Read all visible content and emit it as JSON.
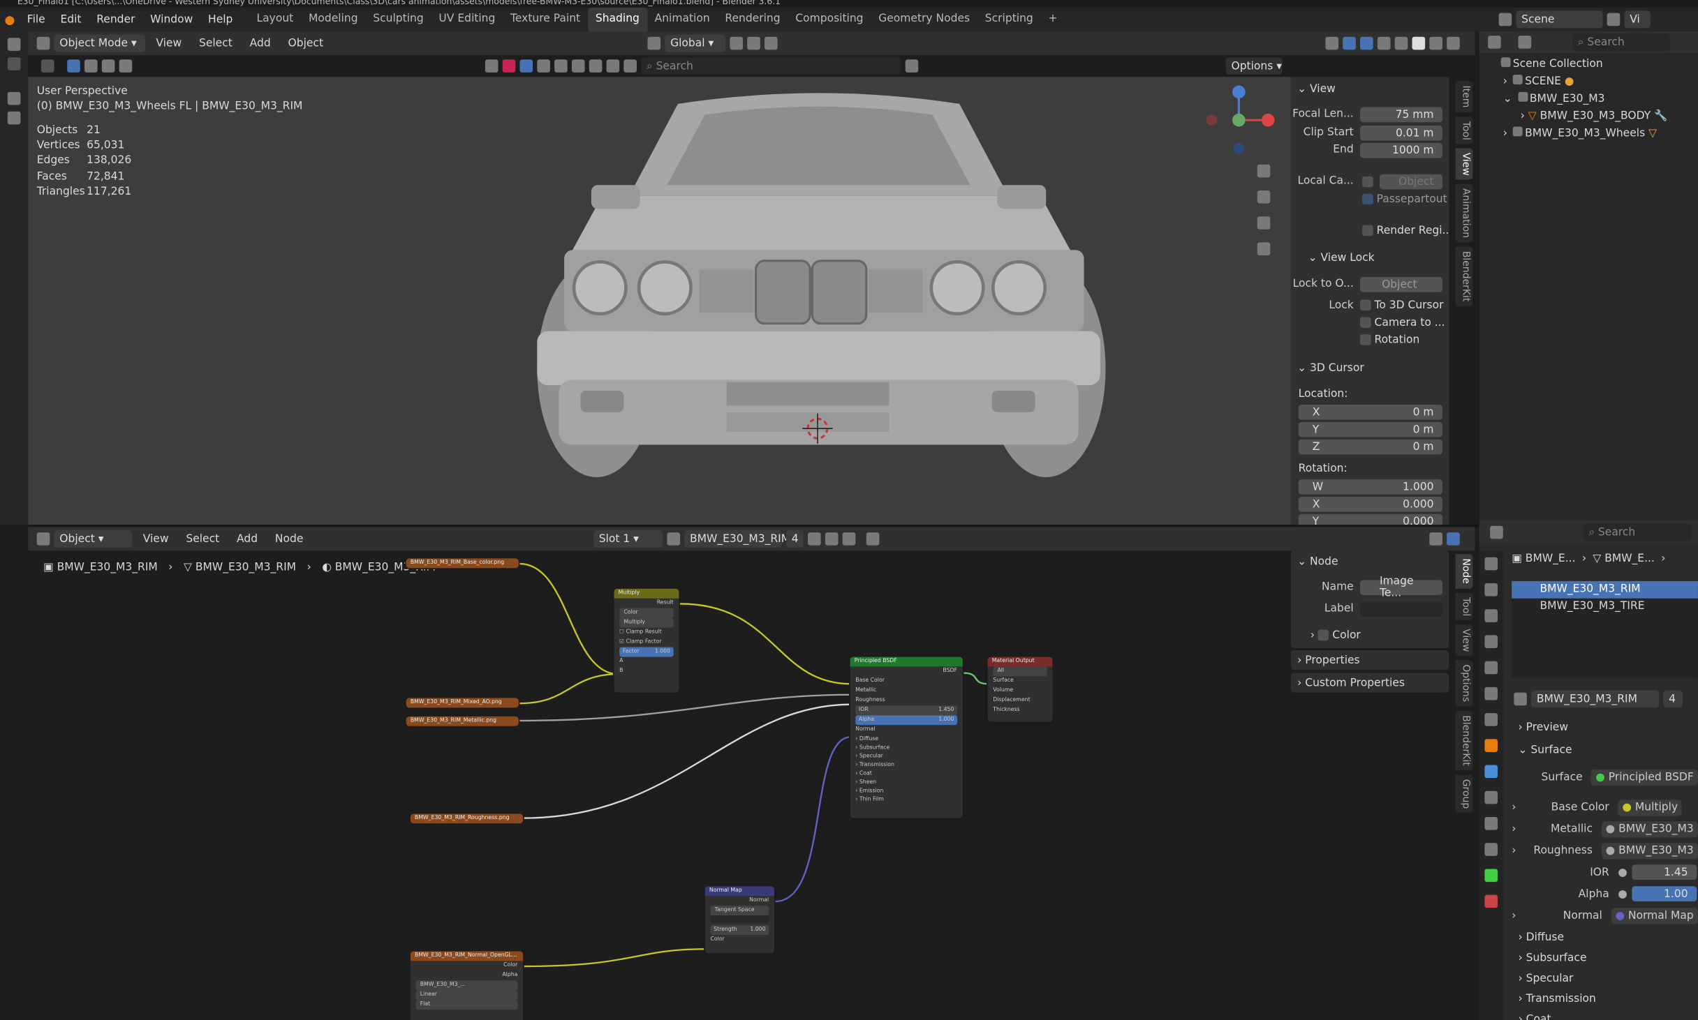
{
  "title_bar": {
    "text": "E30_Finalo1 [C:\\Users\\...\\OneDrive - Western Sydney University\\Documents\\Class\\3D\\cars animation\\assets\\models\\free-BMW-M3-E30\\source\\E30_Finalo1.blend] - Blender 3.6.1"
  },
  "menu": [
    "File",
    "Edit",
    "Render",
    "Window",
    "Help"
  ],
  "workspaces": [
    "Layout",
    "Modeling",
    "Sculpting",
    "UV Editing",
    "Texture Paint",
    "Shading",
    "Animation",
    "Rendering",
    "Compositing",
    "Geometry Nodes",
    "Scripting"
  ],
  "active_workspace": "Shading",
  "scene": {
    "label": "Scene",
    "view_layer": "Vi"
  },
  "viewport": {
    "mode": "Object Mode",
    "menus": [
      "View",
      "Select",
      "Add",
      "Object"
    ],
    "orientation": "Global",
    "options": "Options",
    "search_placeholder": "Search",
    "perspective": "User Perspective",
    "active": "(0) BMW_E30_M3_Wheels FL | BMW_E30_M3_RIM",
    "stats": [
      {
        "label": "Objects",
        "value": "21"
      },
      {
        "label": "Vertices",
        "value": "65,031"
      },
      {
        "label": "Edges",
        "value": "138,026"
      },
      {
        "label": "Faces",
        "value": "72,841"
      },
      {
        "label": "Triangles",
        "value": "117,261"
      }
    ]
  },
  "view_panel": {
    "view_header": "View",
    "focal_label": "Focal Len...",
    "focal_value": "75 mm",
    "clip_start_label": "Clip Start",
    "clip_start_value": "0.01 m",
    "end_label": "End",
    "end_value": "1000 m",
    "local_cam_label": "Local Ca...",
    "local_cam_value": "Object",
    "passepartout": "Passepartout",
    "render_region": "Render Regi...",
    "view_lock_header": "View Lock",
    "lock_to_label": "Lock to O...",
    "lock_to_value": "Object",
    "lock_label": "Lock",
    "to_3d_cursor": "To 3D Cursor",
    "camera_to": "Camera to ...",
    "rotation_cb": "Rotation",
    "cursor_header": "3D Cursor",
    "location_label": "Location:",
    "x_label": "X",
    "x_value": "0 m",
    "y_label": "Y",
    "y_value": "0 m",
    "z_label": "Z",
    "z_value": "0 m",
    "rotation_label": "Rotation:",
    "w_label": "W",
    "w_value": "1.000",
    "rx_label": "X",
    "rx_value": "0.000",
    "ry_label": "Y",
    "ry_value": "0.000"
  },
  "viewport_tabs": [
    "Item",
    "Tool",
    "View",
    "Animation",
    "BlenderKit"
  ],
  "outliner": {
    "search_placeholder": "Search",
    "items": [
      {
        "label": "Scene Collection"
      },
      {
        "label": "SCENE"
      },
      {
        "label": "BMW_E30_M3"
      },
      {
        "label": "BMW_E30_M3_BODY"
      },
      {
        "label": "BMW_E30_M3_Wheels"
      }
    ]
  },
  "node_editor": {
    "type": "Object",
    "menus": [
      "View",
      "Select",
      "Add",
      "Node"
    ],
    "slot": "Slot 1",
    "material": "BMW_E30_M3_RIM",
    "users": "4",
    "breadcrumb": [
      "BMW_E30_M3_RIM",
      "BMW_E30_M3_RIM",
      "BMW_E30_M3_RIM"
    ]
  },
  "node_panel": {
    "node_header": "Node",
    "name_label": "Name",
    "name_value": "Image Te...",
    "label_label": "Label",
    "color_label": "Color",
    "properties": "Properties",
    "custom_properties": "Custom Properties"
  },
  "node_tabs": [
    "Node",
    "Tool",
    "View",
    "Options",
    "BlenderKit",
    "Group"
  ],
  "nodes": {
    "base_color_img": "BMW_E30_M3_RIM_Base_color.png",
    "mixed_ao_img": "BMW_E30_M3_RIM_Mixed_AO.png",
    "metallic_img": "BMW_E30_M3_RIM_Metallic.png",
    "roughness_img": "BMW_E30_M3_RIM_Roughness.png",
    "normal_img": "BMW_E30_M3_RIM_Normal_OpenGL...",
    "normal_img_file": "BMW_E30_M3_...",
    "normal_img_interp": "Linear",
    "normal_img_proj": "Flat",
    "normal_img_color": "Color",
    "normal_img_alpha": "Alpha",
    "multiply": {
      "title": "Multiply",
      "result": "Result",
      "color": "Color",
      "blend": "Multiply",
      "clamp_result": "Clamp Result",
      "clamp_factor": "Clamp Factor",
      "factor_label": "Factor",
      "factor": "1.000",
      "a": "A",
      "b": "B"
    },
    "bsdf": {
      "title": "Principled BSDF",
      "out": "BSDF",
      "base": "Base Color",
      "metallic": "Metallic",
      "roughness": "Roughness",
      "ior_label": "IOR",
      "ior": "1.450",
      "alpha_label": "Alpha",
      "alpha": "1.000",
      "normal": "Normal",
      "subs": [
        "Diffuse",
        "Subsurface",
        "Specular",
        "Transmission",
        "Coat",
        "Sheen",
        "Emission",
        "Thin Film"
      ]
    },
    "output": {
      "title": "Material Output",
      "target": "All",
      "surface": "Surface",
      "volume": "Volume",
      "displacement": "Displacement",
      "thickness": "Thickness"
    },
    "normal_map": {
      "title": "Normal Map",
      "out": "Normal",
      "space": "Tangent Space",
      "strength_label": "Strength",
      "strength": "1.000",
      "color": "Color"
    }
  },
  "properties": {
    "search_placeholder": "Search",
    "crumb1": "BMW_E...",
    "crumb2": "BMW_E...",
    "slots": [
      "BMW_E30_M3_RIM",
      "BMW_E30_M3_TIRE"
    ],
    "material": "BMW_E30_M3_RIM",
    "users": "4",
    "preview": "Preview",
    "surface_header": "Surface",
    "surface_label": "Surface",
    "surface_value": "Principled BSDF",
    "rows": [
      {
        "label": "Base Color",
        "value": "Multiply"
      },
      {
        "label": "Metallic",
        "value": "BMW_E30_M3"
      },
      {
        "label": "Roughness",
        "value": "BMW_E30_M3"
      },
      {
        "label": "IOR",
        "value": "1.45"
      },
      {
        "label": "Alpha",
        "value": "1.00"
      },
      {
        "label": "Normal",
        "value": "Normal Map"
      }
    ],
    "subs": [
      "Diffuse",
      "Subsurface",
      "Specular",
      "Transmission",
      "Coat"
    ]
  },
  "colors": {
    "accent": "#4772b3",
    "yellow_link": "#c7c729",
    "purple_link": "#6363c7",
    "image_node": "#8b4a1b",
    "shader_node": "#1f7a2e"
  }
}
